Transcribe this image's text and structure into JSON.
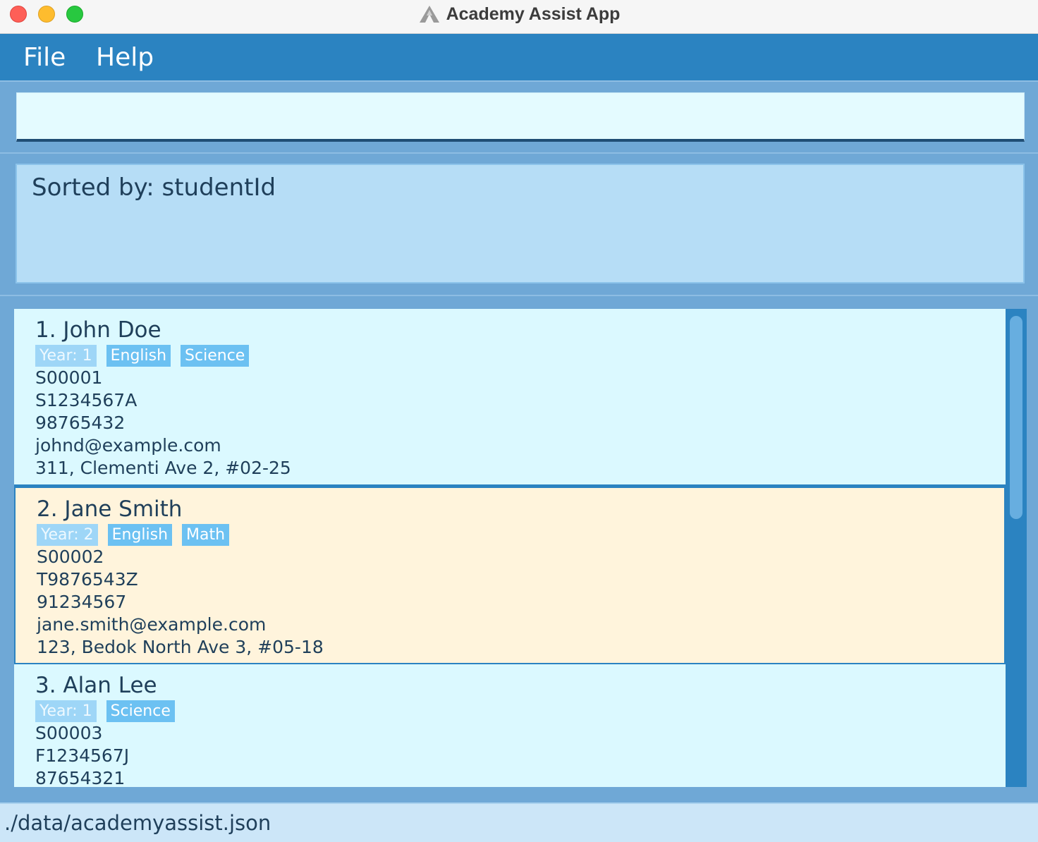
{
  "window": {
    "title": "Academy Assist App"
  },
  "menu": {
    "file": "File",
    "help": "Help"
  },
  "command": {
    "value": "",
    "placeholder": ""
  },
  "result": {
    "text": "Sorted by: studentId"
  },
  "students": [
    {
      "name": "1. John Doe",
      "tags": [
        "Year: 1",
        "English",
        "Science"
      ],
      "id": "S00001",
      "nric": "S1234567A",
      "phone": "98765432",
      "email": "johnd@example.com",
      "address": "311, Clementi Ave 2, #02-25"
    },
    {
      "name": "2. Jane Smith",
      "tags": [
        "Year: 2",
        "English",
        "Math"
      ],
      "id": "S00002",
      "nric": "T9876543Z",
      "phone": "91234567",
      "email": "jane.smith@example.com",
      "address": "123, Bedok North Ave 3, #05-18"
    },
    {
      "name": "3. Alan Lee",
      "tags": [
        "Year: 1",
        "Science"
      ],
      "id": "S00003",
      "nric": "F1234567J",
      "phone": "87654321"
    }
  ],
  "status": {
    "path": "./data/academyassist.json"
  },
  "colors": {
    "menubar": "#2b83c1",
    "selected_card": "#fff4dc",
    "card": "#dbf9ff",
    "tag": "#6cc1f2"
  }
}
